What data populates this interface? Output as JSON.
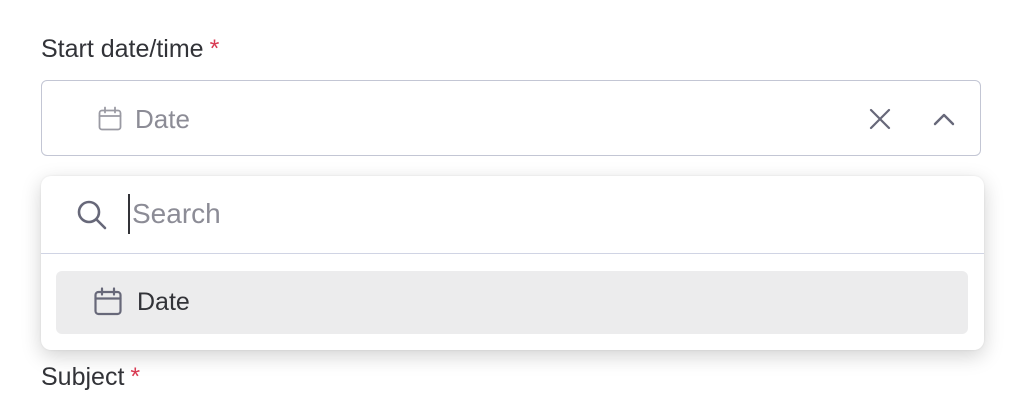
{
  "form": {
    "start_field": {
      "label": "Start date/time",
      "required_mark": "*",
      "selected_value": "Date",
      "value_icon": "calendar-icon",
      "clear_icon": "close-icon",
      "toggle_icon": "chevron-up-icon"
    },
    "subject_field": {
      "label": "Subject",
      "required_mark": "*"
    }
  },
  "dropdown": {
    "search": {
      "placeholder": "Search",
      "value": "",
      "icon": "search-icon"
    },
    "options": [
      {
        "label": "Date",
        "icon": "calendar-icon",
        "highlighted": true
      }
    ]
  },
  "colors": {
    "text": "#323338",
    "muted_text": "#8c8c96",
    "required": "#d83a52",
    "border": "#c3c6d4",
    "option_highlight": "#ececed"
  }
}
